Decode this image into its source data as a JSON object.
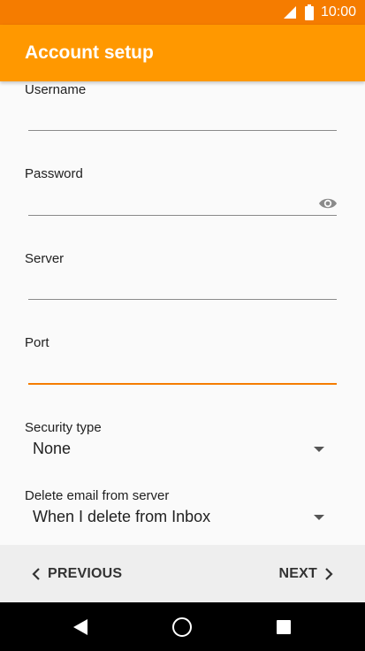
{
  "status_bar": {
    "time": "10:00",
    "icons": [
      "signal-icon",
      "battery-icon"
    ],
    "color": "#f57c00"
  },
  "app_bar": {
    "title": "Account setup",
    "color": "#ff9800"
  },
  "form": {
    "username": {
      "label": "Username",
      "value": ""
    },
    "password": {
      "label": "Password",
      "value": "",
      "icon": "eye-icon"
    },
    "server": {
      "label": "Server",
      "value": ""
    },
    "port": {
      "label": "Port",
      "value": "",
      "focused": true
    },
    "security_type": {
      "label": "Security type",
      "value": "None"
    },
    "delete_email": {
      "label": "Delete email from server",
      "value": "When I delete from Inbox"
    }
  },
  "footer": {
    "previous_label": "PREVIOUS",
    "next_label": "NEXT"
  },
  "system_nav": {
    "icons": [
      "back-icon",
      "home-icon",
      "recents-icon"
    ]
  },
  "colors": {
    "accent": "#f57c00",
    "text": "#212121"
  }
}
